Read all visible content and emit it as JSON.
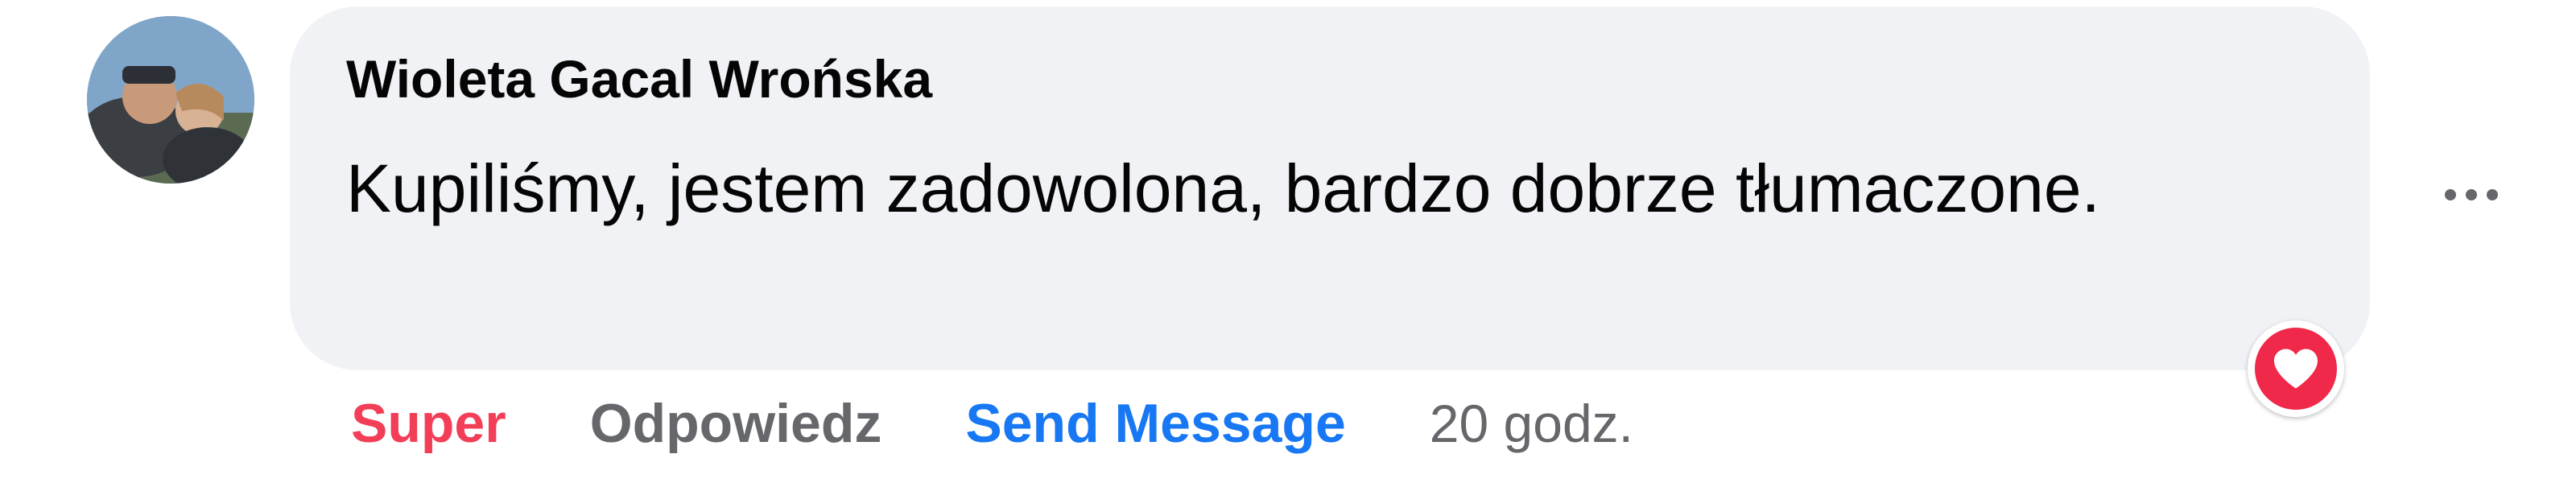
{
  "comment": {
    "author": "Wioleta Gacal Wrońska",
    "text": "Kupiliśmy, jestem zadowolona, bardzo dobrze tłumaczone.",
    "reaction_icon": "heart-icon",
    "reaction_color": "#f02849",
    "more_icon": "more-horizontal-icon"
  },
  "actions": {
    "react_label": "Super",
    "react_color": "#f33e58",
    "reply_label": "Odpowiedz",
    "send_label": "Send Message",
    "send_color": "#1877f2",
    "timestamp": "20 godz."
  },
  "colors": {
    "bubble_background": "#f0f2f5",
    "secondary_text": "#65676b",
    "primary_text": "#050505"
  }
}
